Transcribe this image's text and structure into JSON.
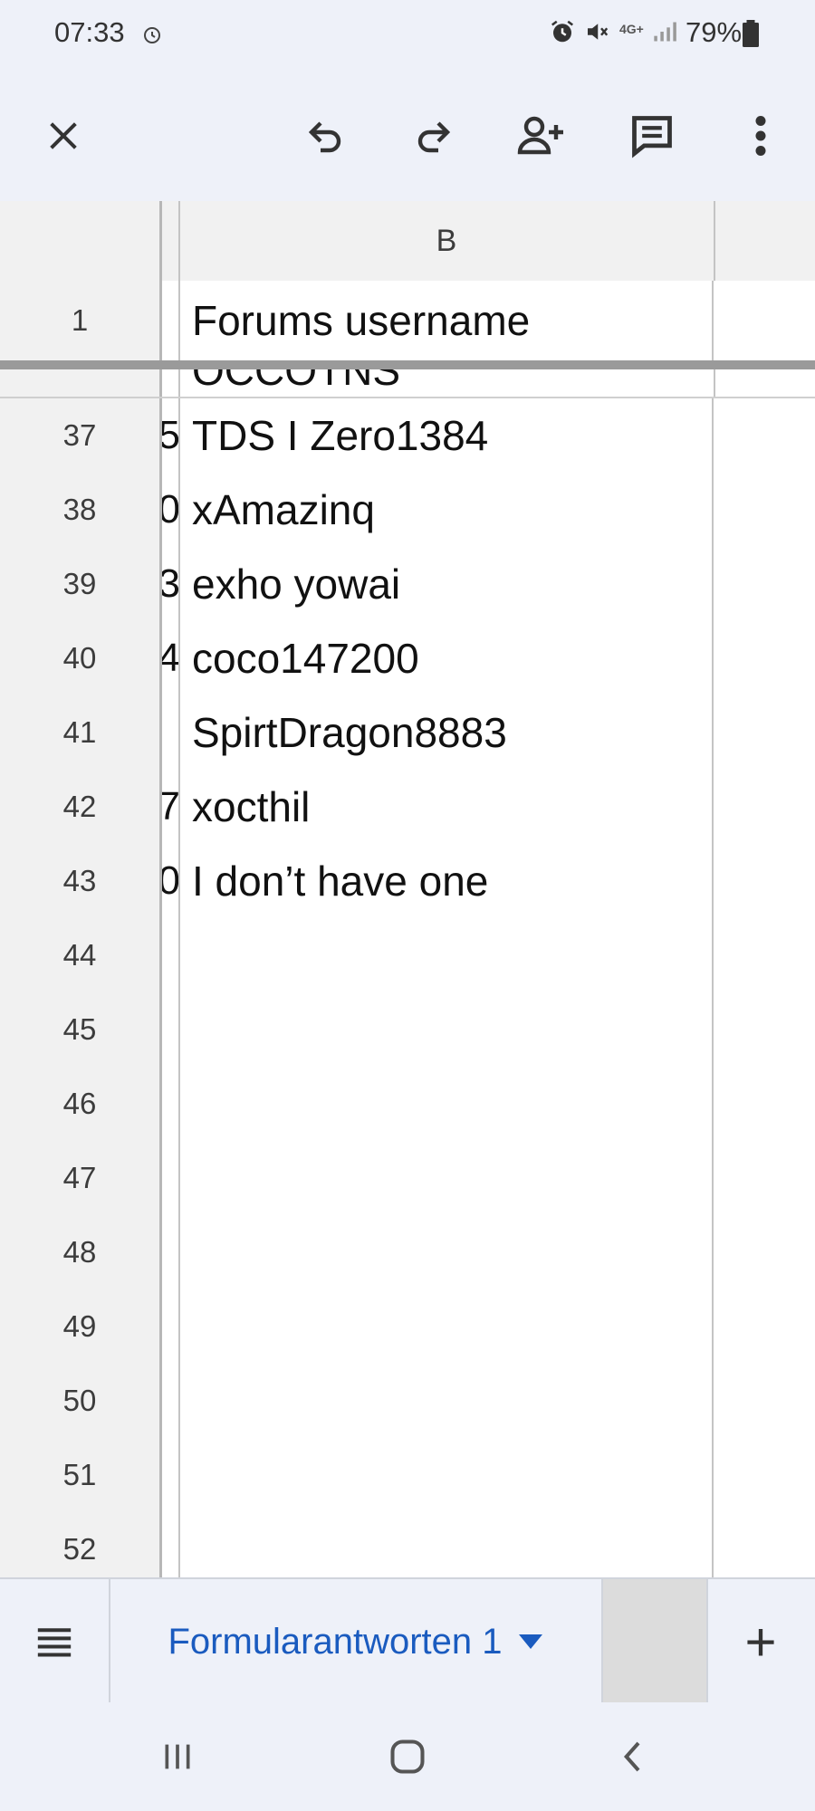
{
  "status_bar": {
    "time": "07:33",
    "battery": "79%",
    "network": "4G+"
  },
  "toolbar": {
    "close_icon": "close-icon",
    "undo_icon": "undo-icon",
    "redo_icon": "redo-icon",
    "share_icon": "add-person-icon",
    "comment_icon": "comment-icon",
    "more_icon": "more-vert-icon"
  },
  "sheet": {
    "column_header": "B",
    "frozen_row": {
      "number": "1",
      "value": "Forums username"
    },
    "partial_row": {
      "value": "OCCOTNS"
    },
    "rows": [
      {
        "number": "37",
        "left_char": "5",
        "value": "TDS I Zero1384"
      },
      {
        "number": "38",
        "left_char": "0",
        "value": "xAmazinq"
      },
      {
        "number": "39",
        "left_char": "3",
        "value": "exho yowai"
      },
      {
        "number": "40",
        "left_char": "4",
        "value": "coco147200"
      },
      {
        "number": "41",
        "left_char": "",
        "value": "SpirtDragon8883"
      },
      {
        "number": "42",
        "left_char": "7",
        "value": "xocthil"
      },
      {
        "number": "43",
        "left_char": "0",
        "value": "I don’t have one"
      },
      {
        "number": "44",
        "left_char": "",
        "value": ""
      },
      {
        "number": "45",
        "left_char": "",
        "value": ""
      },
      {
        "number": "46",
        "left_char": "",
        "value": ""
      },
      {
        "number": "47",
        "left_char": "",
        "value": ""
      },
      {
        "number": "48",
        "left_char": "",
        "value": ""
      },
      {
        "number": "49",
        "left_char": "",
        "value": ""
      },
      {
        "number": "50",
        "left_char": "",
        "value": ""
      },
      {
        "number": "51",
        "left_char": "",
        "value": ""
      },
      {
        "number": "52",
        "left_char": "",
        "value": ""
      }
    ]
  },
  "tabs": {
    "active_label": "Formularantworten 1",
    "add_label": "+"
  },
  "colors": {
    "accent": "#1a5bbf",
    "chrome_bg": "#eef1f9",
    "header_bg": "#f1f1f1"
  }
}
